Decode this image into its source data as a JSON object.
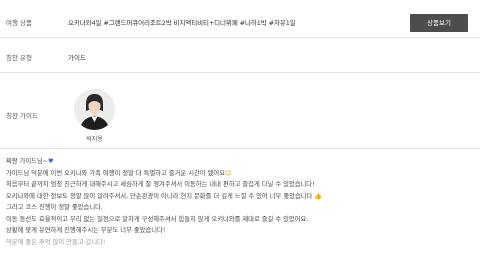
{
  "product": {
    "label": "여행 상품",
    "value": "오키나와4일 #그랜드머큐어리조트2박 비치액티비티+디너뷔페 #나하1박 #자유1일",
    "button_label": "상품보기"
  },
  "compliment_type": {
    "label": "칭찬 유형",
    "value": "가이드"
  },
  "guide": {
    "label": "칭찬 가이드",
    "name": "박지용"
  },
  "review": {
    "lines": [
      {
        "text": "찌짱 가이드님~",
        "emoji": "heart-icon",
        "glyph": "♥"
      },
      {
        "text": "가이드님 덕분에 이번 오키나와 가족 여행이 정말 더 특별하고 즐거운 시간이 됐어요",
        "emoji": "smile-icon",
        "glyph": "☺"
      },
      {
        "text": "처음부터 끝까지 엄청 친근하게 대해주시고 세심하게 잘 챙겨주셔서 이동하는 내내 편하고 즐겁게 다닐 수 있었습니다!",
        "emoji": null,
        "glyph": ""
      },
      {
        "text": "오키나와에 대한 정보도 정말 많이 알려주셔서, 단순관광이 아니라 현지 문화를 더 깊게 느낄 수 있어 너무 좋았습니다",
        "emoji": "thumbs-up-icon",
        "glyph": "👍"
      },
      {
        "text": "그리고 코스 진행이 정말 좋았습니다.",
        "emoji": null,
        "glyph": ""
      },
      {
        "text": "이동 동선도 효율적이고 무리 없는 일정으로 알차게 구성해주셔서 힘들지 않게 오키나와를 제대로 즐길 수 있었어요.",
        "emoji": null,
        "glyph": ""
      },
      {
        "text": "상황에 맞게 유연하게 진행해주시는 부분도 너무 좋았습니다!",
        "emoji": null,
        "glyph": ""
      },
      {
        "text": "덕분에 좋은 추억 많이 만들고 갑니다!",
        "emoji": null,
        "glyph": ""
      }
    ]
  },
  "colors": {
    "button_bg": "#4d4d4d",
    "divider": "#e4e4e4",
    "heart": "#2f6fd6"
  }
}
